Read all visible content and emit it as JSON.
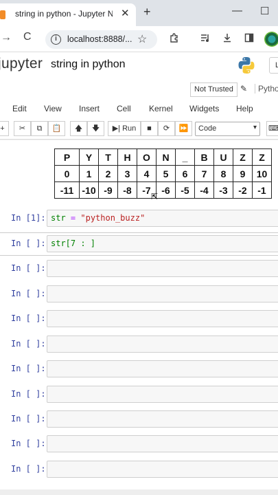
{
  "browser": {
    "tab_title": "string in python - Jupyter Notebook",
    "close_glyph": "✕",
    "new_tab_glyph": "+",
    "minimize_glyph": "—",
    "maximize_glyph": "☐",
    "forward_glyph": "→",
    "reload_glyph": "C",
    "url": "localhost:8888/...",
    "info_glyph": "i",
    "star_glyph": "☆"
  },
  "jupyter": {
    "logo_text": "jupyter",
    "notebook_name": "string in python",
    "logout_label": "L",
    "trust_label": "Not Trusted",
    "kernel_label": "Python"
  },
  "menu": [
    "Edit",
    "View",
    "Insert",
    "Cell",
    "Kernel",
    "Widgets",
    "Help"
  ],
  "toolbar": {
    "run_label": "Run",
    "cell_type": "Code"
  },
  "index_table": {
    "chars": [
      "P",
      "Y",
      "T",
      "H",
      "O",
      "N",
      "_",
      "B",
      "U",
      "Z",
      "Z"
    ],
    "positive": [
      "0",
      "1",
      "2",
      "3",
      "4",
      "5",
      "6",
      "7",
      "8",
      "9",
      "10"
    ],
    "negative": [
      "-11",
      "-10",
      "-9",
      "-8",
      "-7",
      "-6",
      "-5",
      "-4",
      "-3",
      "-2",
      "-1"
    ]
  },
  "cells": [
    {
      "prompt": "In [1]:",
      "code_var": "str",
      "code_op": " = ",
      "code_str": "\"python_buzz\""
    },
    {
      "prompt": "In [ ]:",
      "code": "str[7 : ]"
    },
    {
      "prompt": "In [ ]:"
    },
    {
      "prompt": "In [ ]:"
    },
    {
      "prompt": "In [ ]:"
    },
    {
      "prompt": "In [ ]:"
    },
    {
      "prompt": "In [ ]:"
    },
    {
      "prompt": "In [ ]:"
    },
    {
      "prompt": "In [ ]:"
    },
    {
      "prompt": "In [ ]:"
    },
    {
      "prompt": "In [ ]:"
    }
  ]
}
